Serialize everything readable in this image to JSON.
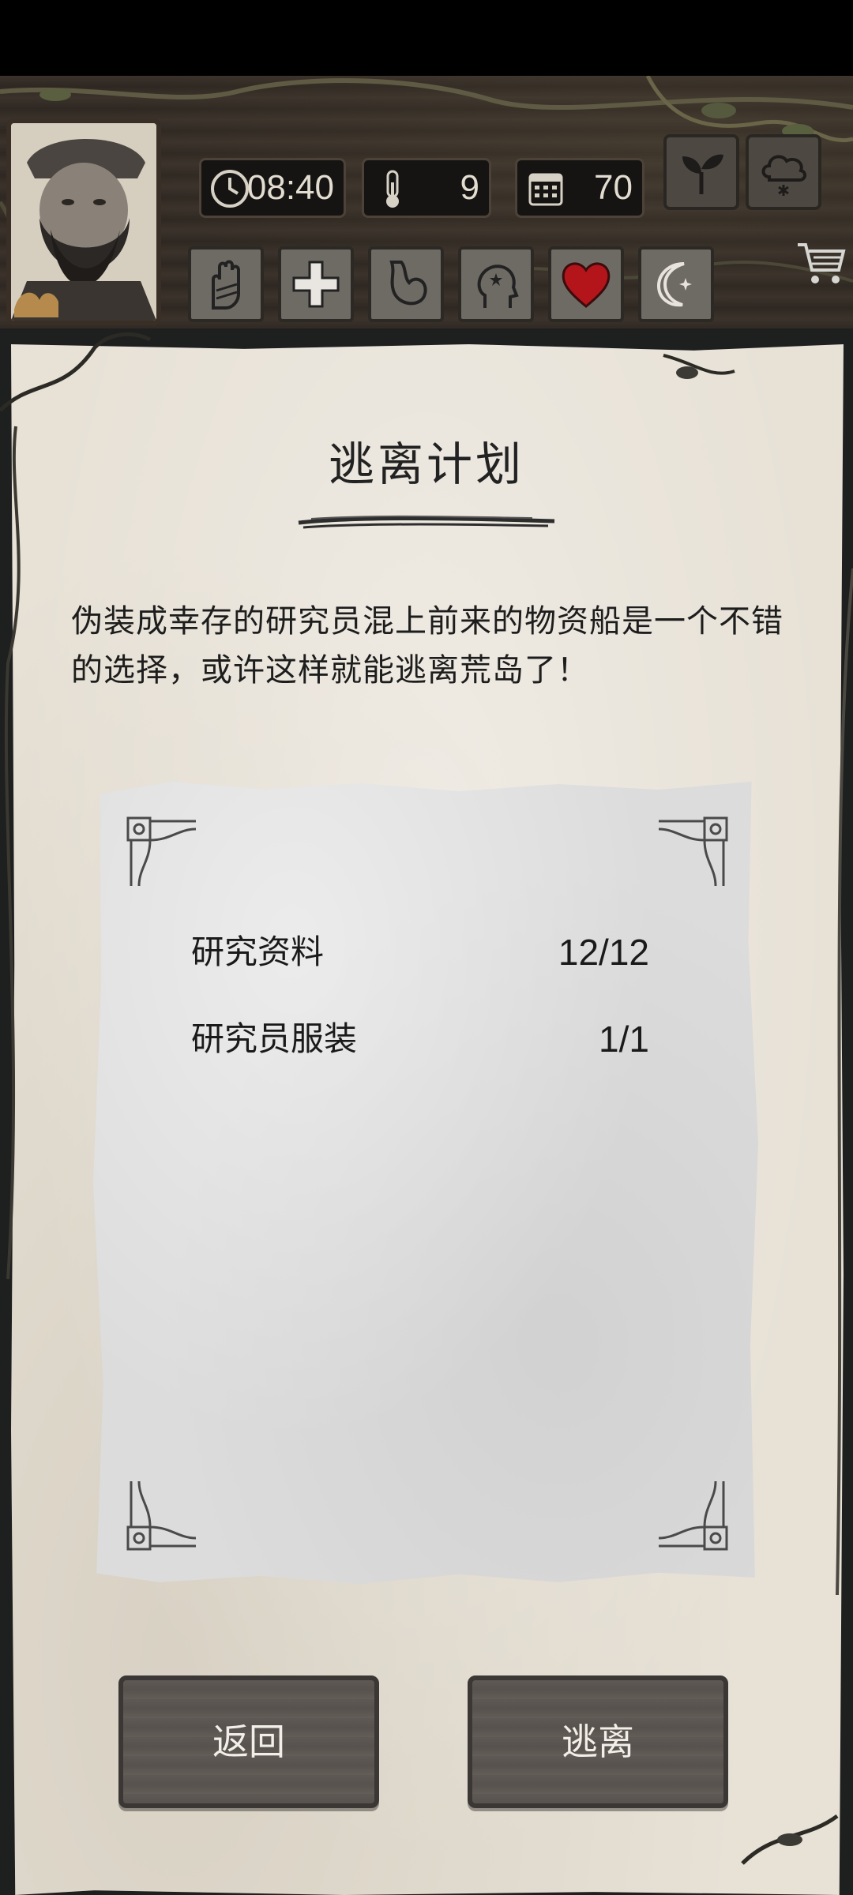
{
  "hud": {
    "time": "08:40",
    "temperature": "9",
    "day": "70",
    "icons": {
      "clock": "clock-icon",
      "thermometer": "thermometer-icon",
      "calendar": "calendar-icon",
      "sprout": "sprout-icon",
      "weather": "cloud-snow-icon",
      "cart": "shopping-cart-icon"
    },
    "status_icons": [
      "hand-icon",
      "cross-health-icon",
      "stomach-icon",
      "head-mind-icon",
      "heart-icon",
      "moon-star-icon"
    ]
  },
  "panel": {
    "title": "逃离计划",
    "description": "伪装成幸存的研究员混上前来的物资船是一个不错的选择，或许这样就能逃离荒岛了！",
    "requirements": [
      {
        "label": "研究资料",
        "count": "12/12"
      },
      {
        "label": "研究员服装",
        "count": "1/1"
      }
    ]
  },
  "buttons": {
    "back": "返回",
    "escape": "逃离"
  },
  "colors": {
    "parchment": "#e7e1d6",
    "card": "#dcdcdc",
    "wood": "#312a24",
    "heart": "#b3151b",
    "button": "#5e5954"
  }
}
